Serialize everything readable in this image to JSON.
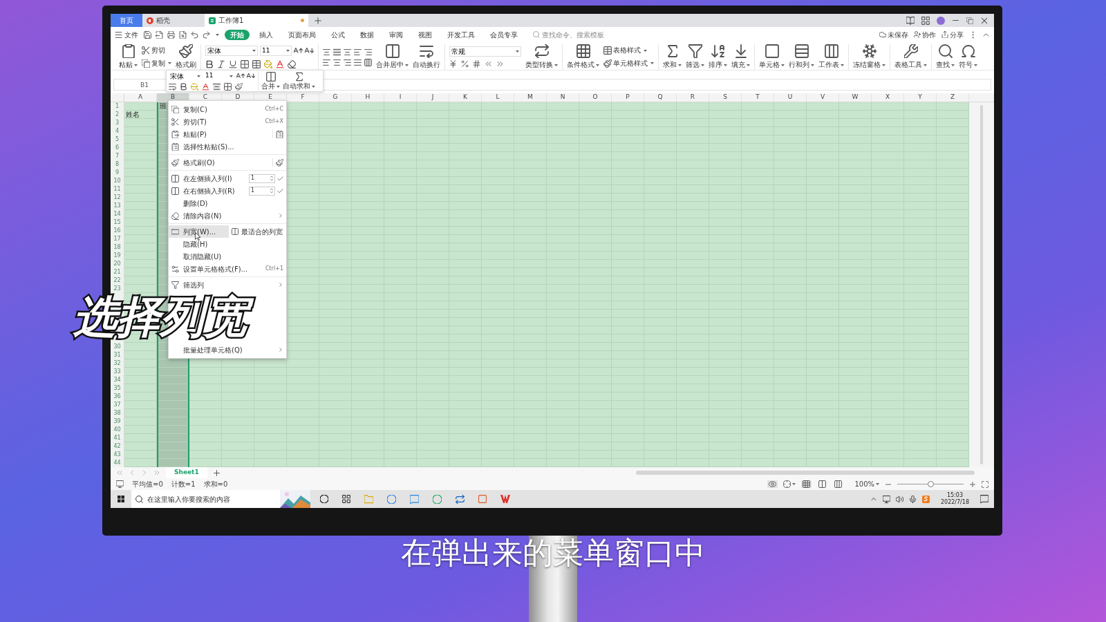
{
  "window_tabs": [
    {
      "kind": "home",
      "label": "首页",
      "selected": false
    },
    {
      "kind": "doc",
      "label": "稻壳",
      "selected": false,
      "unsaved": false
    },
    {
      "kind": "sheet",
      "label": "工作簿1",
      "selected": true,
      "unsaved": true
    }
  ],
  "menu": {
    "file": "文件",
    "tabs": [
      {
        "label": "开始",
        "selected": true
      },
      {
        "label": "插入",
        "selected": false
      },
      {
        "label": "页面布局",
        "selected": false
      },
      {
        "label": "公式",
        "selected": false
      },
      {
        "label": "数据",
        "selected": false
      },
      {
        "label": "审阅",
        "selected": false
      },
      {
        "label": "视图",
        "selected": false
      },
      {
        "label": "开发工具",
        "selected": false
      },
      {
        "label": "会员专享",
        "selected": false
      }
    ],
    "search": {
      "placeholder": "查找命令、搜索模板"
    },
    "actions": [
      "未保存",
      "协作",
      "分享"
    ]
  },
  "ribbon": [
    [
      {
        "kind": "big",
        "label": "粘贴",
        "dropdown": true
      },
      {
        "kind": "stack",
        "items": [
          {
            "label": "剪切",
            "dropdown": false
          },
          {
            "label": "复制",
            "dropdown": true
          }
        ]
      },
      {
        "kind": "big",
        "label": "格式刷",
        "dropdown": false
      }
    ],
    [
      {
        "kind": "font",
        "font": "宋体",
        "size": "11"
      }
    ],
    [
      {
        "kind": "align"
      },
      {
        "kind": "big",
        "label": "合并居中",
        "dropdown": true
      },
      {
        "kind": "big",
        "label": "自动换行",
        "dropdown": false
      }
    ],
    [
      {
        "kind": "number",
        "format": "常规"
      },
      {
        "kind": "big",
        "label": "类型转换",
        "dropdown": true
      }
    ],
    [
      {
        "kind": "big",
        "label": "条件格式",
        "dropdown": true
      },
      {
        "kind": "stack",
        "items": [
          {
            "label": "表格样式",
            "dropdown": true
          },
          {
            "label": "单元格样式",
            "dropdown": true
          }
        ]
      }
    ],
    [
      {
        "kind": "big",
        "label": "求和",
        "dropdown": true
      },
      {
        "kind": "big",
        "label": "筛选",
        "dropdown": true
      },
      {
        "kind": "big",
        "label": "排序",
        "dropdown": true
      },
      {
        "kind": "big",
        "label": "填充",
        "dropdown": true
      }
    ],
    [
      {
        "kind": "big",
        "label": "单元格",
        "dropdown": true
      },
      {
        "kind": "big",
        "label": "行和列",
        "dropdown": true
      },
      {
        "kind": "big",
        "label": "工作表",
        "dropdown": true
      }
    ],
    [
      {
        "kind": "big",
        "label": "冻结窗格",
        "dropdown": true
      }
    ],
    [
      {
        "kind": "big",
        "label": "表格工具",
        "dropdown": true
      }
    ],
    [
      {
        "kind": "big",
        "label": "查找",
        "dropdown": true
      },
      {
        "kind": "big",
        "label": "符号",
        "dropdown": true
      }
    ]
  ],
  "mini_toolbar": {
    "font": "宋体",
    "size": "11",
    "buttons": [
      "合并",
      "自动求和"
    ]
  },
  "formula_bar": {
    "cell": "B1"
  },
  "sheet": {
    "columns": [
      {
        "label": "A",
        "selected": false
      },
      {
        "label": "B",
        "selected": true
      },
      {
        "label": "C",
        "selected": false
      },
      {
        "label": "D",
        "selected": false
      },
      {
        "label": "E",
        "selected": false
      },
      {
        "label": "F",
        "selected": false
      },
      {
        "label": "G",
        "selected": false
      },
      {
        "label": "H",
        "selected": false
      },
      {
        "label": "I",
        "selected": false
      },
      {
        "label": "J",
        "selected": false
      },
      {
        "label": "K",
        "selected": false
      },
      {
        "label": "L",
        "selected": false
      },
      {
        "label": "M",
        "selected": false
      },
      {
        "label": "N",
        "selected": false
      },
      {
        "label": "O",
        "selected": false
      },
      {
        "label": "P",
        "selected": false
      },
      {
        "label": "Q",
        "selected": false
      },
      {
        "label": "R",
        "selected": false
      },
      {
        "label": "S",
        "selected": false
      },
      {
        "label": "T",
        "selected": false
      },
      {
        "label": "U",
        "selected": false
      },
      {
        "label": "V",
        "selected": false
      },
      {
        "label": "W",
        "selected": false
      },
      {
        "label": "X",
        "selected": false
      },
      {
        "label": "Y",
        "selected": false
      },
      {
        "label": "Z",
        "selected": false
      }
    ],
    "rows": [
      {
        "header": "1",
        "cells": [
          null,
          "班"
        ]
      },
      {
        "header": "2",
        "cells": [
          "姓名"
        ]
      },
      {
        "header": "3"
      },
      {
        "header": "4"
      },
      {
        "header": "5"
      },
      {
        "header": "6"
      },
      {
        "header": "7"
      },
      {
        "header": "8"
      },
      {
        "header": "9"
      },
      {
        "header": "10"
      },
      {
        "header": "11"
      },
      {
        "header": "12"
      },
      {
        "header": "13"
      },
      {
        "header": "14"
      },
      {
        "header": "15"
      },
      {
        "header": "16"
      },
      {
        "header": "17"
      },
      {
        "header": "18"
      },
      {
        "header": "19"
      },
      {
        "header": "20"
      },
      {
        "header": "21"
      },
      {
        "header": "22"
      },
      {
        "header": "23"
      },
      {
        "header": null
      },
      {
        "header": null
      },
      {
        "header": null
      },
      {
        "header": null
      },
      {
        "header": null
      },
      {
        "header": null
      },
      {
        "header": "30"
      },
      {
        "header": "31"
      },
      {
        "header": "32"
      },
      {
        "header": "33"
      },
      {
        "header": "34"
      },
      {
        "header": "35"
      },
      {
        "header": "36"
      },
      {
        "header": "37"
      },
      {
        "header": "38"
      },
      {
        "header": "39"
      },
      {
        "header": "40"
      },
      {
        "header": "41"
      },
      {
        "header": "42"
      },
      {
        "header": "43"
      },
      {
        "header": "44"
      }
    ]
  },
  "context_menu": [
    {
      "kind": "item",
      "label": "复制(C)",
      "shortcut": "Ctrl+C",
      "selected": false
    },
    {
      "kind": "item",
      "label": "剪切(T)",
      "shortcut": "Ctrl+X",
      "selected": false
    },
    {
      "kind": "item",
      "label": "粘贴(P)",
      "extra": true,
      "selected": false
    },
    {
      "kind": "item",
      "label": "选择性粘贴(S)...",
      "selected": false
    },
    {
      "kind": "separator"
    },
    {
      "kind": "item",
      "label": "格式刷(O)",
      "extra": true,
      "selected": false
    },
    {
      "kind": "separator"
    },
    {
      "kind": "count",
      "label": "在左侧插入列(I)",
      "value": "1"
    },
    {
      "kind": "count",
      "label": "在右侧插入列(R)",
      "value": "1"
    },
    {
      "kind": "item",
      "label": "删除(D)",
      "selected": false
    },
    {
      "kind": "item",
      "label": "清除内容(N)",
      "submenu": true,
      "selected": false
    },
    {
      "kind": "separator"
    },
    {
      "kind": "item",
      "label": "列宽(W)...",
      "side": "最适合的列宽",
      "selected": true
    },
    {
      "kind": "item",
      "label": "隐藏(H)",
      "selected": false
    },
    {
      "kind": "item",
      "label": "取消隐藏(U)",
      "selected": false
    },
    {
      "kind": "item",
      "label": "设置单元格格式(F)...",
      "shortcut": "Ctrl+1",
      "selected": false
    },
    {
      "kind": "separator"
    },
    {
      "kind": "item",
      "label": "筛选列",
      "submenu": true,
      "selected": false
    },
    {
      "kind": "item",
      "label": "批量处理单元格(Q)",
      "submenu": true,
      "selected": false
    }
  ],
  "sheet_tabs": [
    {
      "label": "Sheet1",
      "selected": true
    }
  ],
  "status_bar": {
    "stats": [
      "平均值=0",
      "计数=1",
      "求和=0"
    ],
    "views": [
      {
        "selected": true
      },
      {
        "selected": false
      },
      {
        "selected": false
      }
    ],
    "zoom": "100%",
    "zoom_slider": {
      "level": 0.5
    }
  },
  "taskbar": {
    "search": {
      "placeholder": "在这里输入你要搜索的内容"
    },
    "time": "15:03",
    "date": "2022/7/18"
  },
  "overlay_title": "选择列宽",
  "caption": "在弹出来的菜单窗口中"
}
